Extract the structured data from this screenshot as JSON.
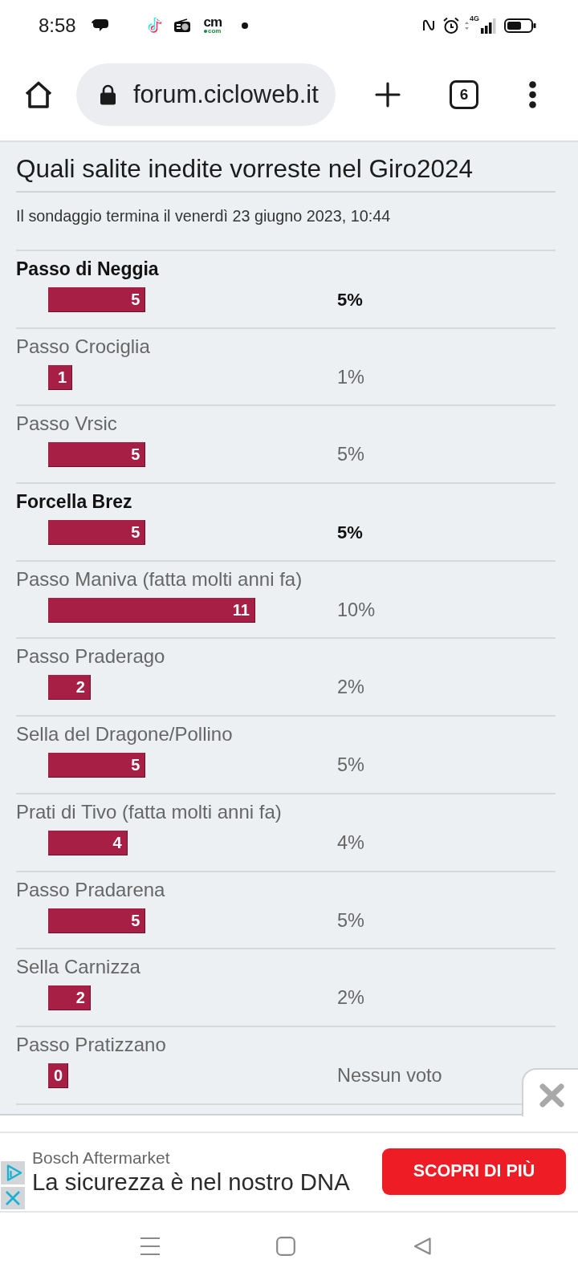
{
  "status_bar": {
    "time": "8:58",
    "app_logo": {
      "text": "cm",
      "subtext": "com"
    },
    "network": "4G"
  },
  "browser": {
    "url": "forum.cicloweb.it",
    "tab_count": "6"
  },
  "poll": {
    "title": "Quali salite inedite vorreste nel Giro2024",
    "end_note": "Il sondaggio termina il venerdì 23 giugno 2023, 10:44",
    "options": [
      {
        "label": "Passo di Neggia",
        "votes": "5",
        "percent": "5%",
        "voted": true
      },
      {
        "label": "Passo Crociglia",
        "votes": "1",
        "percent": "1%",
        "voted": false
      },
      {
        "label": "Passo Vrsic",
        "votes": "5",
        "percent": "5%",
        "voted": false
      },
      {
        "label": "Forcella Brez",
        "votes": "5",
        "percent": "5%",
        "voted": true
      },
      {
        "label": "Passo Maniva (fatta molti anni fa)",
        "votes": "11",
        "percent": "10%",
        "voted": false
      },
      {
        "label": "Passo Praderago",
        "votes": "2",
        "percent": "2%",
        "voted": false
      },
      {
        "label": "Sella del Dragone/Pollino",
        "votes": "5",
        "percent": "5%",
        "voted": false
      },
      {
        "label": "Prati di Tivo (fatta molti anni fa)",
        "votes": "4",
        "percent": "4%",
        "voted": false
      },
      {
        "label": "Passo Pradarena",
        "votes": "5",
        "percent": "5%",
        "voted": false
      },
      {
        "label": "Sella Carnizza",
        "votes": "2",
        "percent": "2%",
        "voted": false
      },
      {
        "label": "Passo Pratizzano",
        "votes": "0",
        "percent": "Nessun voto",
        "voted": false
      }
    ]
  },
  "ad": {
    "advertiser": "Bosch Aftermarket",
    "headline": "La sicurezza è nel nostro DNA",
    "button": "SCOPRI DI PIÙ"
  }
}
